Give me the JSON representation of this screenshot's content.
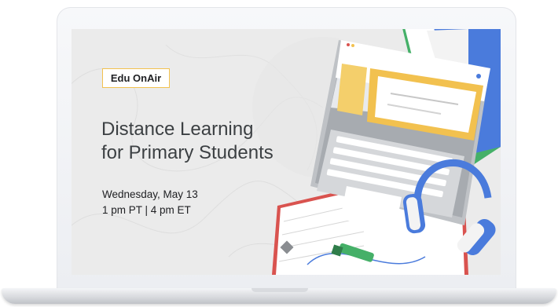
{
  "badge": {
    "label": "Edu OnAir"
  },
  "event": {
    "title_line1": "Distance Learning",
    "title_line2": "for Primary Students",
    "date": "Wednesday, May 13",
    "time": "1 pm PT | 4 pm ET"
  },
  "colors": {
    "accent_yellow": "#f2c14f",
    "blue": "#4a7bdc",
    "green": "#45b068",
    "red": "#d9534f",
    "background": "#ebebeb"
  },
  "icons": [
    "laptop-illustration",
    "headphones-illustration",
    "book-illustration",
    "highlighter-illustration"
  ]
}
